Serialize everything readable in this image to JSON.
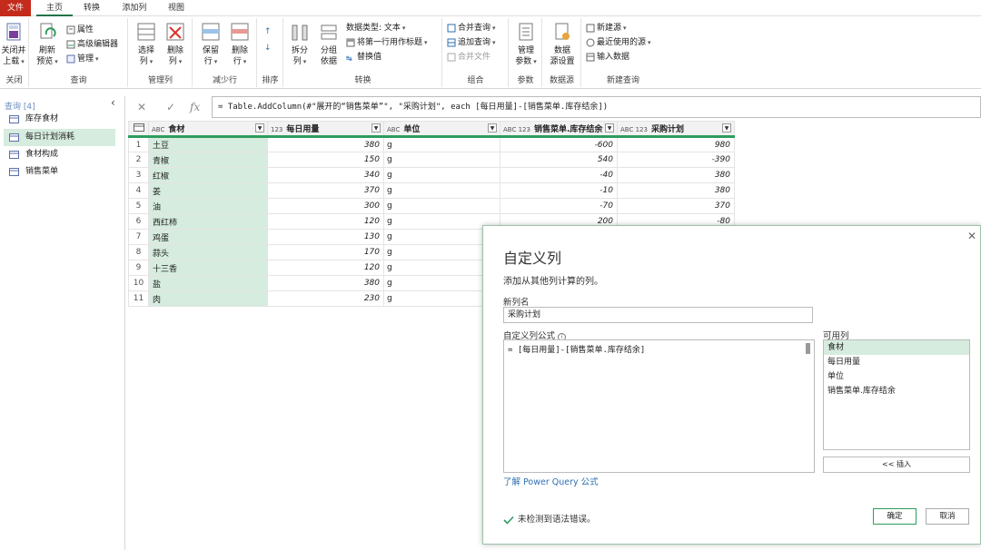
{
  "tabs": [
    "文件",
    "主页",
    "转换",
    "添加列",
    "视图"
  ],
  "ribbon": {
    "groups": [
      {
        "name": "关闭",
        "buttons": [
          "关闭并上载"
        ]
      },
      {
        "name": "查询",
        "buttons": [
          "刷新预览",
          "属性",
          "高级编辑器",
          "管理"
        ]
      },
      {
        "name": "管理列",
        "buttons": [
          "选择列",
          "删除列"
        ]
      },
      {
        "name": "减少行",
        "buttons": [
          "保留行",
          "删除行"
        ]
      },
      {
        "name": "排序",
        "buttons": []
      },
      {
        "name": "转换",
        "buttons": [
          "拆分列",
          "分组依据",
          "数据类型: 文本",
          "将第一行用作标题",
          "替换值"
        ]
      },
      {
        "name": "组合",
        "buttons": [
          "合并查询",
          "追加查询",
          "合并文件"
        ]
      },
      {
        "name": "参数",
        "buttons": [
          "管理参数"
        ]
      },
      {
        "name": "数据源",
        "buttons": [
          "数据源设置"
        ]
      },
      {
        "name": "新建查询",
        "buttons": [
          "新建源",
          "最近使用的源",
          "输入数据"
        ]
      }
    ],
    "close_l1": "关闭并",
    "close_l2": "上载",
    "refresh_l1": "刷新",
    "refresh_l2": "预览",
    "props": "属性",
    "adv_editor": "高级编辑器",
    "manage": "管理",
    "selcol_l1": "选择",
    "selcol_l2": "列",
    "delcol_l1": "删除",
    "delcol_l2": "列",
    "keeprow_l1": "保留",
    "keeprow_l2": "行",
    "delrow_l1": "删除",
    "delrow_l2": "行",
    "split_l1": "拆分",
    "split_l2": "列",
    "group_l1": "分组",
    "group_l2": "依据",
    "datatype": "数据类型: 文本",
    "first_row_header": "将第一行用作标题",
    "replace": "替换值",
    "merge_q": "合并查询",
    "append_q": "追加查询",
    "merge_files": "合并文件",
    "manage_param_l1": "管理",
    "manage_param_l2": "参数",
    "ds_l1": "数据",
    "ds_l2": "源设置",
    "new_source": "新建源",
    "recent_source": "最近使用的源",
    "enter_data": "输入数据"
  },
  "queries": {
    "header": "查询 [4]",
    "items": [
      {
        "label": "库存食材"
      },
      {
        "label": "每日计划消耗"
      },
      {
        "label": "食材构成"
      },
      {
        "label": "销售菜单"
      }
    ]
  },
  "formula_bar": {
    "text": "= Table.AddColumn(#\"展开的“销售菜单”\", \"采购计划\", each [每日用量]-[销售菜单.库存结余])"
  },
  "grid": {
    "columns": [
      {
        "type": "ABC",
        "name": "食材"
      },
      {
        "type": "123",
        "name": "每日用量"
      },
      {
        "type": "ABC",
        "name": "单位"
      },
      {
        "type": "ABC 123",
        "name": "销售菜单.库存结余"
      },
      {
        "type": "ABC 123",
        "name": "采购计划"
      }
    ],
    "rows": [
      [
        "1",
        "土豆",
        "380",
        "g",
        "-600",
        "980"
      ],
      [
        "2",
        "青椒",
        "150",
        "g",
        "540",
        "-390"
      ],
      [
        "3",
        "红椒",
        "340",
        "g",
        "-40",
        "380"
      ],
      [
        "4",
        "姜",
        "370",
        "g",
        "-10",
        "380"
      ],
      [
        "5",
        "油",
        "300",
        "g",
        "-70",
        "370"
      ],
      [
        "6",
        "西红柿",
        "120",
        "g",
        "200",
        "-80"
      ],
      [
        "7",
        "鸡蛋",
        "130",
        "g",
        "",
        ""
      ],
      [
        "8",
        "蒜头",
        "170",
        "g",
        "",
        ""
      ],
      [
        "9",
        "十三香",
        "120",
        "g",
        "",
        ""
      ],
      [
        "10",
        "盐",
        "380",
        "g",
        "",
        ""
      ],
      [
        "11",
        "肉",
        "230",
        "g",
        "",
        ""
      ]
    ]
  },
  "dialog": {
    "title": "自定义列",
    "subtitle": "添加从其他列计算的列。",
    "new_col_label": "新列名",
    "new_col_value": "采购计划",
    "formula_label": "自定义列公式",
    "formula": "= [每日用量]-[销售菜单.库存结余]",
    "available_label": "可用列",
    "available": [
      "食材",
      "每日用量",
      "单位",
      "销售菜单.库存结余"
    ],
    "insert": "<< 插入",
    "learn": "了解 Power Query 公式",
    "status": "未检测到语法错误。",
    "ok": "确定",
    "cancel": "取消"
  },
  "colors": {
    "accent": "#217346",
    "file_tab": "#c42b1c",
    "selection": "#d6ecdf"
  }
}
